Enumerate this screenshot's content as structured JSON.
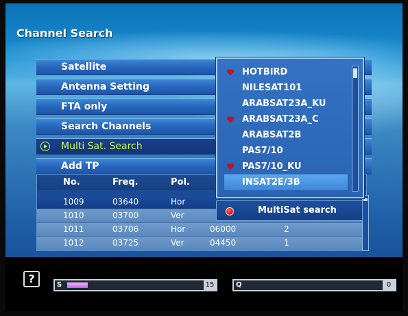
{
  "screen": {
    "title": "Channel Search"
  },
  "menu": {
    "items": [
      {
        "label": "Satellite"
      },
      {
        "label": "Antenna Setting"
      },
      {
        "label": "FTA only"
      },
      {
        "label": "Search Channels"
      },
      {
        "label": "Multi Sat. Search"
      },
      {
        "label": "Add TP"
      }
    ],
    "active_index": 4
  },
  "satellite_list": {
    "items": [
      {
        "name": "HOTBIRD",
        "favorite": true
      },
      {
        "name": "NILESAT101",
        "favorite": false
      },
      {
        "name": "ARABSAT23A_KU",
        "favorite": false
      },
      {
        "name": "ARABSAT23A_C",
        "favorite": true
      },
      {
        "name": "ARABSAT2B",
        "favorite": false
      },
      {
        "name": "PAS7/10",
        "favorite": false
      },
      {
        "name": "PAS7/10_KU",
        "favorite": true
      },
      {
        "name": "INSAT2E/3B",
        "favorite": false
      }
    ],
    "selected_index": 7,
    "heart_icon": "heart-icon",
    "heart_color": "#c0151c"
  },
  "multisat": {
    "label": "MultiSat search",
    "icon": "red-dot-icon"
  },
  "tp_table": {
    "headers": [
      "No.",
      "Freq.",
      "Pol."
    ],
    "rows": [
      {
        "no": "1009",
        "freq": "03640",
        "pol": "Hor",
        "sr": "",
        "fec": ""
      },
      {
        "no": "1010",
        "freq": "03700",
        "pol": "Ver",
        "sr": "",
        "fec": ""
      },
      {
        "no": "1011",
        "freq": "03706",
        "pol": "Hor",
        "sr": "06000",
        "fec": "2"
      },
      {
        "no": "1012",
        "freq": "03725",
        "pol": "Ver",
        "sr": "04450",
        "fec": "1"
      }
    ],
    "selected_index": 0
  },
  "status": {
    "help_label": "?",
    "strength": {
      "key": "S",
      "value": "15",
      "level": 0.15
    },
    "quality": {
      "key": "Q",
      "value": "0",
      "level": 0
    }
  },
  "colors": {
    "accent": "#c8ff50",
    "panel": "#2a63b2",
    "selection": "#3d86d8"
  }
}
